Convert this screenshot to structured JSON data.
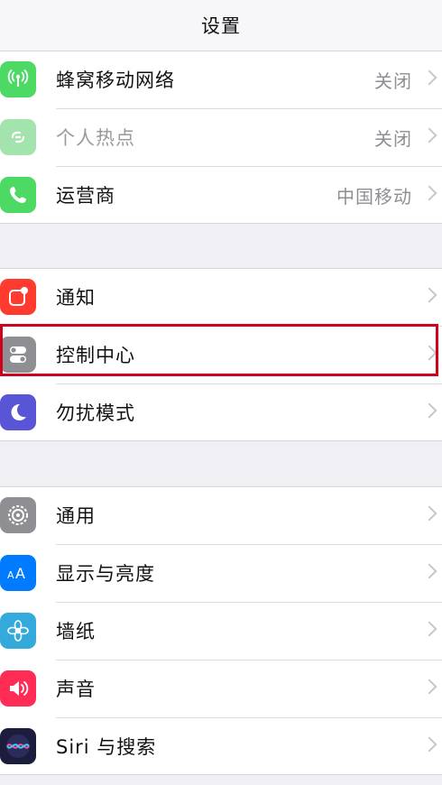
{
  "header": {
    "title": "设置"
  },
  "groups": [
    {
      "items": [
        {
          "label": "蜂窝移动网络",
          "value": "关闭",
          "icon": "antenna-icon",
          "color": "#4cd964"
        },
        {
          "label": "个人热点",
          "value": "关闭",
          "icon": "link-icon",
          "color": "#a3e3ad",
          "dimmed": true
        },
        {
          "label": "运营商",
          "value": "中国移动",
          "icon": "phone-icon",
          "color": "#4cd964"
        }
      ]
    },
    {
      "items": [
        {
          "label": "通知",
          "icon": "notification-icon",
          "color": "#ff3b30"
        },
        {
          "label": "控制中心",
          "icon": "toggle-icon",
          "color": "#8e8e93",
          "highlighted": true
        },
        {
          "label": "勿扰模式",
          "icon": "moon-icon",
          "color": "#5856d6"
        }
      ]
    },
    {
      "items": [
        {
          "label": "通用",
          "icon": "gear-icon",
          "color": "#8e8e93"
        },
        {
          "label": "显示与亮度",
          "icon": "text-size-icon",
          "color": "#007aff"
        },
        {
          "label": "墙纸",
          "icon": "flower-icon",
          "color": "#34aadc"
        },
        {
          "label": "声音",
          "icon": "speaker-icon",
          "color": "#ff2d55"
        },
        {
          "label": "Siri 与搜索",
          "icon": "siri-icon",
          "color": "#1c1c3c"
        }
      ]
    }
  ],
  "colors": {
    "highlight": "#d0021b",
    "background": "#efeff4"
  }
}
